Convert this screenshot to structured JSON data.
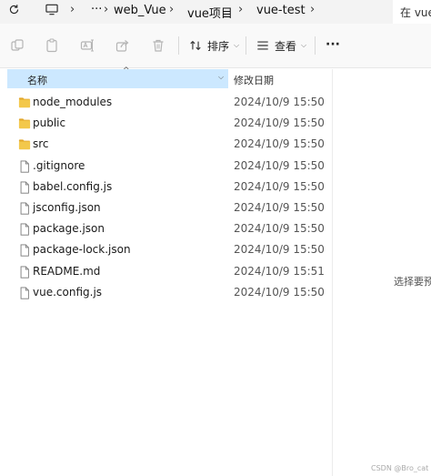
{
  "address_bar": {
    "icons": [
      "refresh-icon",
      "monitor-icon",
      "more-icon"
    ],
    "more": "···",
    "breadcrumbs": [
      "web_Vue",
      "vue项目",
      "vue-test"
    ],
    "search_placeholder": "在 vue"
  },
  "toolbar": {
    "icons": [
      "cut-icon",
      "copy-icon",
      "rename-icon",
      "share-icon",
      "delete-icon"
    ],
    "sort_label": "排序",
    "view_label": "查看",
    "more_label": "···"
  },
  "list": {
    "columns": {
      "name": "名称",
      "modified": "修改日期"
    },
    "rows": [
      {
        "name": "node_modules",
        "date": "2024/10/9 15:50",
        "type": "folder"
      },
      {
        "name": "public",
        "date": "2024/10/9 15:50",
        "type": "folder"
      },
      {
        "name": "src",
        "date": "2024/10/9 15:50",
        "type": "folder"
      },
      {
        "name": ".gitignore",
        "date": "2024/10/9 15:50",
        "type": "file"
      },
      {
        "name": "babel.config.js",
        "date": "2024/10/9 15:50",
        "type": "file"
      },
      {
        "name": "jsconfig.json",
        "date": "2024/10/9 15:50",
        "type": "file"
      },
      {
        "name": "package.json",
        "date": "2024/10/9 15:50",
        "type": "file"
      },
      {
        "name": "package-lock.json",
        "date": "2024/10/9 15:50",
        "type": "file"
      },
      {
        "name": "README.md",
        "date": "2024/10/9 15:51",
        "type": "file"
      },
      {
        "name": "vue.config.js",
        "date": "2024/10/9 15:50",
        "type": "file"
      }
    ]
  },
  "preview": {
    "text": "选择要预览"
  },
  "watermark": "CSDN @Bro_cat",
  "colors": {
    "header_bg": "#cce8ff",
    "folder": "#f3c84b",
    "toolbar_bg": "#f9f9f9"
  }
}
